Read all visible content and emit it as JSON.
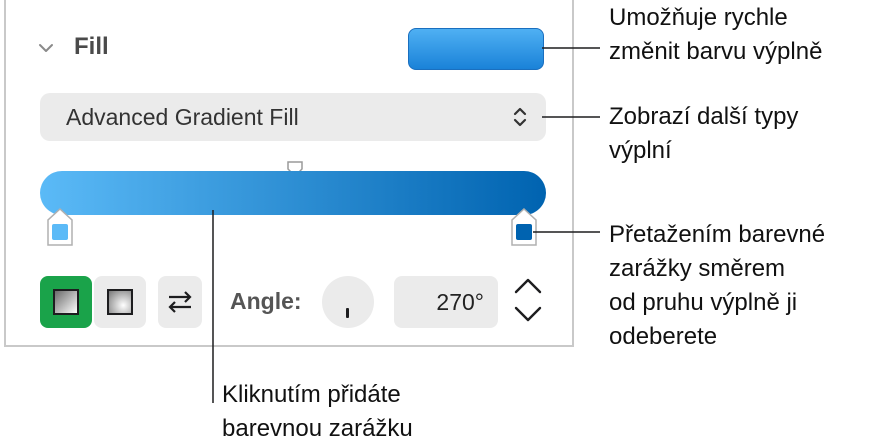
{
  "panel": {
    "section_title": "Fill",
    "fill_type": "Advanced Gradient Fill",
    "angle_label": "Angle:",
    "angle_value": "270°",
    "swatch_color": "#2a90e2",
    "gradient_start_color": "#5bbaf7",
    "gradient_end_color": "#0063b0",
    "active_button_color": "#1aa34a",
    "icons": [
      "chevron-down-icon",
      "up-down-arrows-icon",
      "linear-gradient-icon",
      "radial-gradient-icon",
      "swap-arrows-icon",
      "angle-dial-icon",
      "stepper-arrows-icon"
    ]
  },
  "callouts": {
    "color_well": "Umožňuje rychle\nzměnit barvu výplně",
    "popup": "Zobrazí další typy\nvýplní",
    "drag_stop": "Přetažením barevné\nzarážky směrem\nod pruhu výplně ji\nodeberete",
    "add_stop": "Kliknutím přidáte\nbarevnou zarážku"
  }
}
